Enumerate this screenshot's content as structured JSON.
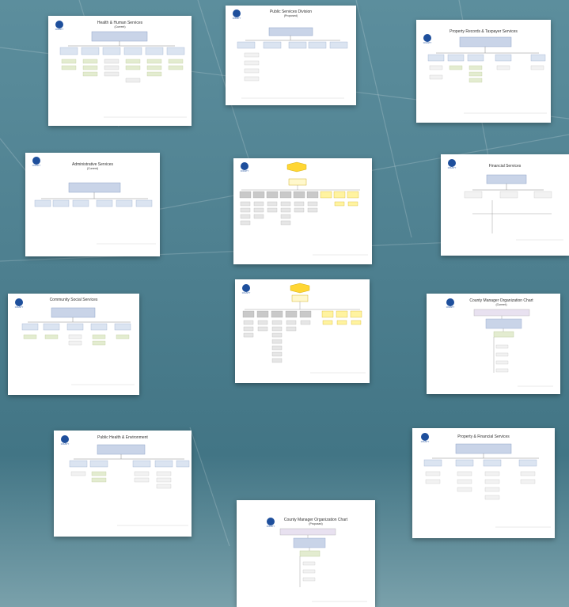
{
  "slides": [
    {
      "id": "health",
      "title": "Health & Human Services",
      "subtitle": "(Current)"
    },
    {
      "id": "public-services",
      "title": "Public Services Division",
      "subtitle": "(Proposed)"
    },
    {
      "id": "property-taxpayer",
      "title": "Property Records & Taxpayer Services",
      "subtitle": ""
    },
    {
      "id": "admin",
      "title": "Administrative Services",
      "subtitle": "(Current)"
    },
    {
      "id": "center-top",
      "title": "",
      "subtitle": ""
    },
    {
      "id": "financial",
      "title": "Financial Services",
      "subtitle": ""
    },
    {
      "id": "community",
      "title": "Community Social Services",
      "subtitle": ""
    },
    {
      "id": "center-mid",
      "title": "",
      "subtitle": ""
    },
    {
      "id": "county-mgr-right",
      "title": "County Manager Organization Chart",
      "subtitle": "(Current)"
    },
    {
      "id": "public-health",
      "title": "Public Health & Environment",
      "subtitle": ""
    },
    {
      "id": "property-financial",
      "title": "Property & Financial Services",
      "subtitle": ""
    },
    {
      "id": "county-mgr-bottom",
      "title": "County Manager Organization Chart",
      "subtitle": "(Proposed)"
    }
  ],
  "logo_text": "COUNTY"
}
